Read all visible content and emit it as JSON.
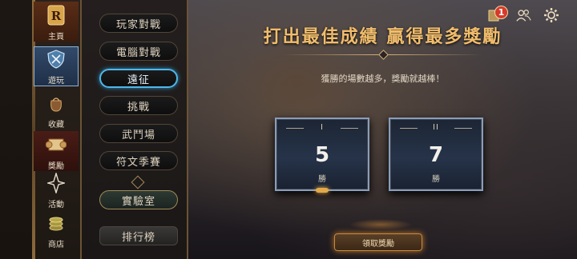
{
  "nav": {
    "items": [
      {
        "label": "主頁",
        "icon": "legends-r-icon"
      },
      {
        "label": "遊玩",
        "icon": "shield-swords-icon"
      },
      {
        "label": "收藏",
        "icon": "bag-icon"
      },
      {
        "label": "獎勵",
        "icon": "scroll-icon"
      },
      {
        "label": "活動",
        "icon": "compass-star-icon"
      },
      {
        "label": "商店",
        "icon": "coin-stack-icon"
      }
    ],
    "active": "遊玩"
  },
  "menu": {
    "buttons": [
      "玩家對戰",
      "電腦對戰",
      "遠征",
      "挑戰",
      "武鬥場",
      "符文季賽"
    ],
    "active": "遠征",
    "lab": "實驗室",
    "ranking": "排行榜"
  },
  "main": {
    "title": "打出最佳成績 贏得最多獎勵",
    "subtitle": "獲勝的場數越多，獎勵就越棒！",
    "cards": [
      {
        "tier": "I",
        "wins": "5",
        "unit": "勝"
      },
      {
        "tier": "II",
        "wins": "7",
        "unit": "勝"
      }
    ],
    "claim_button": "領取獎勵"
  },
  "top_right": {
    "notification_count": "1",
    "icons": [
      "mail-icon",
      "friends-icon",
      "gear-icon"
    ]
  },
  "colors": {
    "title_gold": "#f1bd6c",
    "active_blue": "#4fb8e8",
    "badge_red": "#d63a2a"
  }
}
